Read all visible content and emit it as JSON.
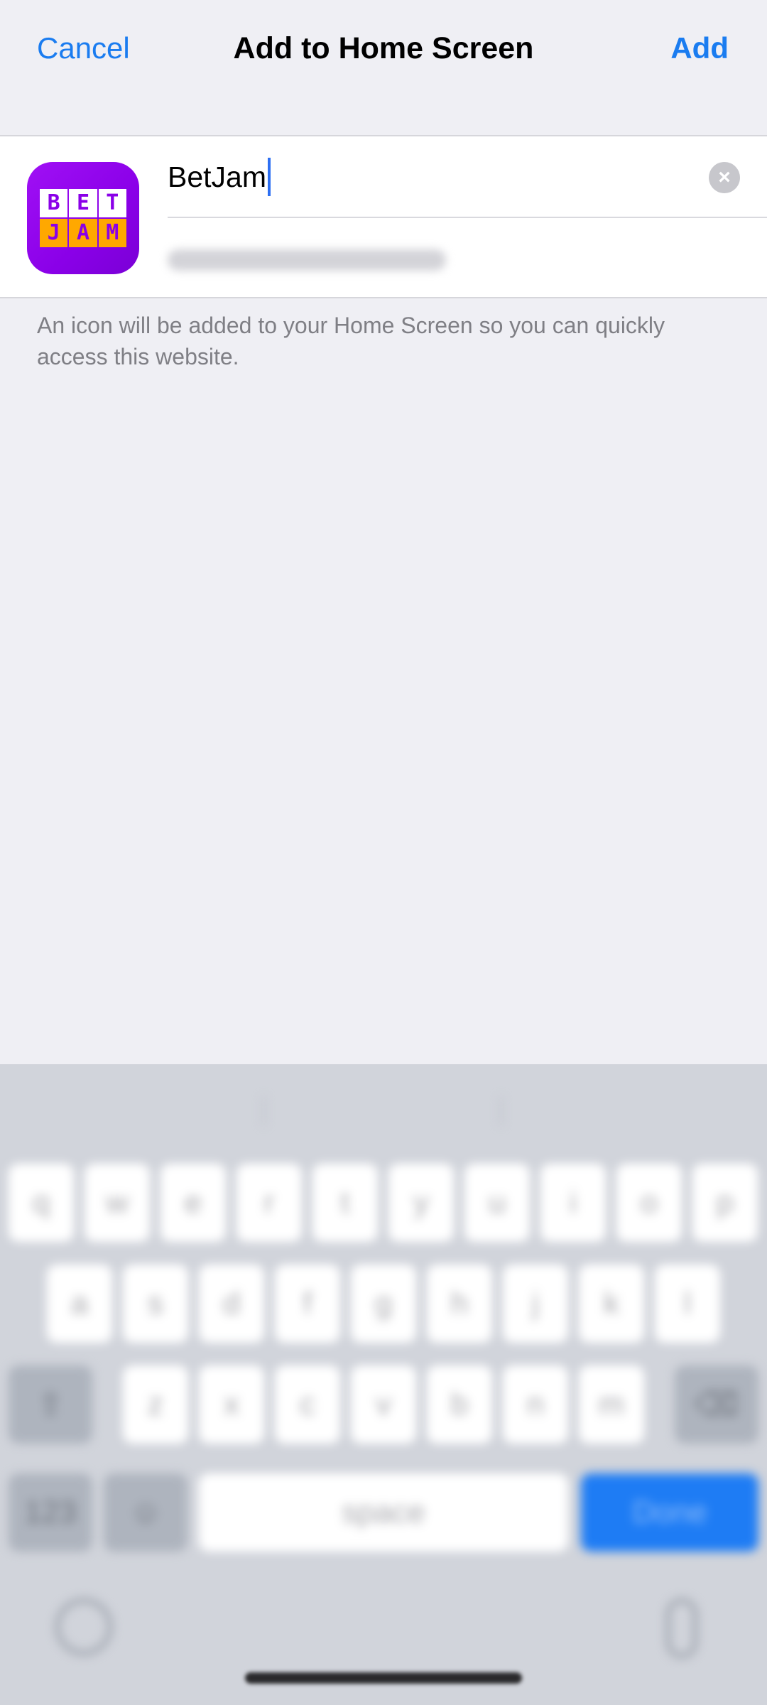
{
  "navbar": {
    "cancel_label": "Cancel",
    "title": "Add to Home Screen",
    "add_label": "Add"
  },
  "app": {
    "icon_logo_top": [
      "B",
      "E",
      "T"
    ],
    "icon_logo_bottom": [
      "J",
      "A",
      "M"
    ],
    "name_value": "BetJam"
  },
  "footnote": "An icon will be added to your Home Screen so you can quickly access this website.",
  "keyboard": {
    "row1": [
      "q",
      "w",
      "e",
      "r",
      "t",
      "y",
      "u",
      "i",
      "o",
      "p"
    ],
    "row2": [
      "a",
      "s",
      "d",
      "f",
      "g",
      "h",
      "j",
      "k",
      "l"
    ],
    "row3": [
      "z",
      "x",
      "c",
      "v",
      "b",
      "n",
      "m"
    ],
    "space_label": "space",
    "numbers_label": "123",
    "done_label": "Done"
  },
  "colors": {
    "accent": "#1a7cf0",
    "icon_purple": "#8a00e8",
    "icon_orange": "#ffa800",
    "keyboard_bg": "#d1d4db"
  }
}
